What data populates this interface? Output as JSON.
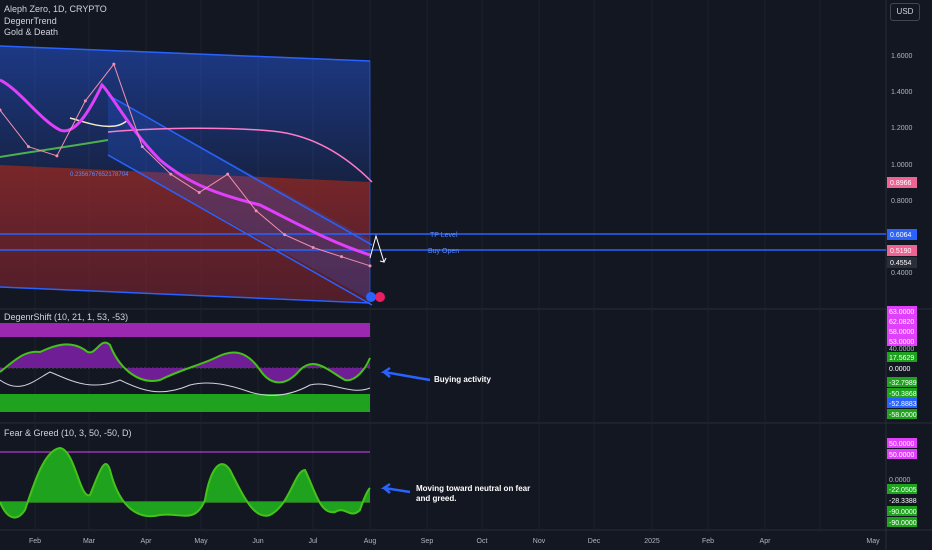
{
  "header": {
    "symbol": "Aleph Zero, 1D, CRYPTO",
    "indicator1": "DegenrTrend",
    "indicator2": "Gold & Death",
    "currency": "USD"
  },
  "main_panel": {
    "price_ticks": [
      "1.6000",
      "1.4000",
      "1.2000",
      "1.0000",
      "0.8000",
      "0.4000"
    ],
    "tag_ma": "0.8966",
    "tag_tp": "0.6064",
    "tag_buy": "0.5190",
    "tag_price": "0.4554",
    "tp_label": "TP Level",
    "buy_label": "Buy Open",
    "fib_text": "0.2356767652178704"
  },
  "osc1": {
    "title": "DegenrShift (10, 21, 1, 53, -53)",
    "tags": [
      "63.0000",
      "62.0820",
      "58.0000",
      "53.0000",
      "40.0000",
      "17.5629",
      "0.0000",
      "-32.7989",
      "-50.3868",
      "-52.8883",
      "-58.0000"
    ],
    "note": "Buying activity"
  },
  "osc2": {
    "title": "Fear & Greed (10, 3, 50, -50, D)",
    "tags": [
      "50.0000",
      "50.0000",
      "0.0000",
      "-22.0505",
      "-28.3388",
      "-90.0000",
      "-90.0000"
    ],
    "note_line1": "Moving toward neutral on fear",
    "note_line2": "and greed."
  },
  "time_axis": [
    "Feb",
    "Mar",
    "Apr",
    "May",
    "Jun",
    "Jul",
    "Aug",
    "Sep",
    "Oct",
    "Nov",
    "Dec",
    "2025",
    "Feb",
    "Apr",
    "May"
  ],
  "colors": {
    "background": "#131722",
    "channel_blue": "#2962ff",
    "magenta": "#e040fb",
    "green_line": "#4caf50",
    "fill_red": "#8b2a2a",
    "tag_pink": "#f06292",
    "tag_blue": "#2962ff",
    "osc_green": "#44c21a",
    "osc_purple": "#9c27b0"
  },
  "chart_data": {
    "type": "line",
    "series": [
      {
        "name": "price",
        "x": [
          "Jan 20",
          "Feb 1",
          "Feb 15",
          "Mar 1",
          "Mar 15",
          "Apr 1",
          "Apr 15",
          "May 1",
          "May 15",
          "Jun 1",
          "Jun 15",
          "Jul 1",
          "Jul 15",
          "Jul 31"
        ],
        "values": [
          1.3,
          1.1,
          1.05,
          1.35,
          1.55,
          1.1,
          0.95,
          0.85,
          0.95,
          0.75,
          0.62,
          0.55,
          0.5,
          0.45
        ]
      }
    ],
    "ylim": [
      0.3,
      1.7
    ]
  }
}
